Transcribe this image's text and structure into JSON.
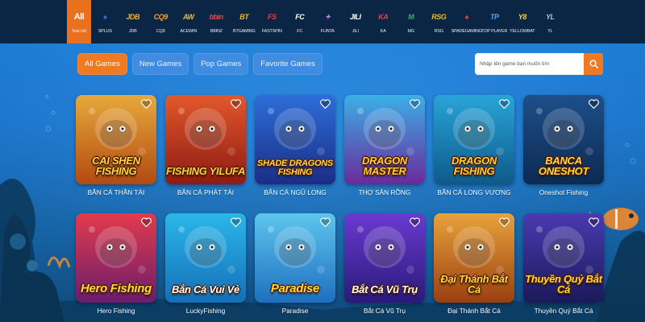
{
  "providers": [
    {
      "logo": "All",
      "name": "Toàn bộ",
      "color": "#ffffff",
      "active": true
    },
    {
      "logo": "♠",
      "name": "SPLUS",
      "color": "#3d6df2"
    },
    {
      "logo": "JDB",
      "name": "JDB",
      "color": "#e9b23a"
    },
    {
      "logo": "CQ9",
      "name": "CQ9",
      "color": "#f0a43b"
    },
    {
      "logo": "AW",
      "name": "ACEWIN",
      "color": "#e8c033"
    },
    {
      "logo": "bbin",
      "name": "BBIN2",
      "color": "#e84a4a"
    },
    {
      "logo": "BT",
      "name": "BTGAMING",
      "color": "#e8b931"
    },
    {
      "logo": "FS",
      "name": "FASTSPIN",
      "color": "#ef3b3b"
    },
    {
      "logo": "FC",
      "name": "FC",
      "color": "#ffffff"
    },
    {
      "logo": "✦",
      "name": "FUNTA",
      "color": "#b97ae8"
    },
    {
      "logo": "JILI",
      "name": "JILI",
      "color": "#ffffff"
    },
    {
      "logo": "KA",
      "name": "KA",
      "color": "#d94747"
    },
    {
      "logo": "M",
      "name": "MG",
      "color": "#39b36b"
    },
    {
      "logo": "RSG",
      "name": "RSG",
      "color": "#e8b931"
    },
    {
      "logo": "♠",
      "name": "SPADEGAMING",
      "color": "#e04b3d"
    },
    {
      "logo": "TP",
      "name": "TOP PLAYER",
      "color": "#4aa7f0"
    },
    {
      "logo": "Y8",
      "name": "YELLOWBAT",
      "color": "#f2d13c"
    },
    {
      "logo": "YL",
      "name": "YL",
      "color": "#9fc4ef"
    }
  ],
  "tabs": [
    {
      "label": "All Games",
      "active": true
    },
    {
      "label": "New Games"
    },
    {
      "label": "Pop Games"
    },
    {
      "label": "Favorite Games"
    }
  ],
  "search": {
    "placeholder": "Nhập tên game bạn muốn tìm"
  },
  "games": [
    {
      "name": "BẮN CÁ THẦN TÀI",
      "art_title": "CAI SHEN FISHING",
      "bg": [
        "#e7a93b",
        "#b24a12"
      ],
      "text": "#ffd93b"
    },
    {
      "name": "BẮN CÁ PHÁT TÀI",
      "art_title": "FISHING YILUFA",
      "bg": [
        "#e2582b",
        "#8e1b13"
      ],
      "text": "#ffcf3a"
    },
    {
      "name": "BẮN CÁ NGŨ LONG",
      "art_title": "SHADE DRAGONS FISHING",
      "bg": [
        "#2d6ed8",
        "#1a2d86"
      ],
      "text": "#ffd64a"
    },
    {
      "name": "THỢ SĂN RỒNG",
      "art_title": "DRAGON MASTER",
      "bg": [
        "#3bb0e8",
        "#6a2a9a"
      ],
      "text": "#ffcf3a"
    },
    {
      "name": "BẮN CÁ LONG VƯƠNG",
      "art_title": "DRAGON FISHING",
      "bg": [
        "#2aa4d8",
        "#0d5a8a"
      ],
      "text": "#ffcf3a"
    },
    {
      "name": "Oneshot Fishing",
      "art_title": "BANCA ONESHOT",
      "bg": [
        "#1d4f8a",
        "#0c2a52"
      ],
      "text": "#ffd93b"
    },
    {
      "name": "Hero Fishing",
      "art_title": "Hero Fishing",
      "bg": [
        "#e33b4a",
        "#6a1d6e"
      ],
      "text": "#ffd93b"
    },
    {
      "name": "LuckyFishing",
      "art_title": "Bắn Cá Vui Vẻ",
      "bg": [
        "#2bb7e8",
        "#146fb8"
      ],
      "text": "#ffffff"
    },
    {
      "name": "Paradise",
      "art_title": "Paradise",
      "bg": [
        "#5ec6ee",
        "#1f6fbf"
      ],
      "text": "#ffd93b"
    },
    {
      "name": "Bắt Cá Vũ Trụ",
      "art_title": "Bắt Cá Vũ Trụ",
      "bg": [
        "#6a3ad0",
        "#2a1a7a"
      ],
      "text": "#ffffff"
    },
    {
      "name": "Đại Thánh Bắt Cá",
      "art_title": "Đại Thánh Bắt Cá",
      "bg": [
        "#e8a23b",
        "#9a3f10"
      ],
      "text": "#ffd93b"
    },
    {
      "name": "Thuyền Quý Bắt Cá",
      "art_title": "Thuyền Quỷ Bắt Cá",
      "bg": [
        "#4a3ab0",
        "#1a1a5a"
      ],
      "text": "#ffd93b"
    }
  ],
  "colors": {
    "accent": "#f07a22",
    "tab_bg": "#3f8ce0",
    "topbar": "#0b2544"
  }
}
